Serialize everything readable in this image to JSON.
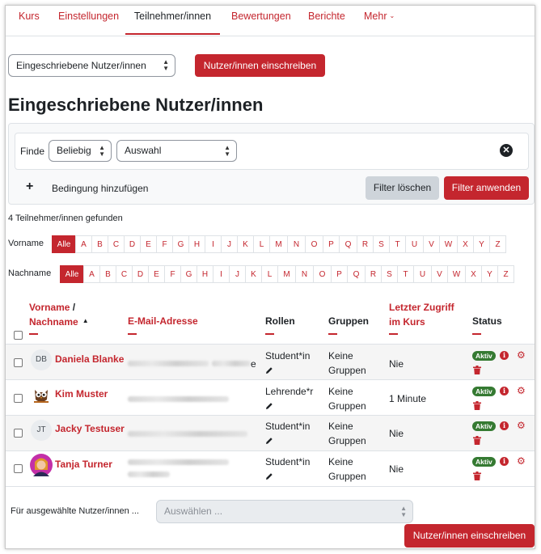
{
  "nav": {
    "tabs": [
      "Kurs",
      "Einstellungen",
      "Teilnehmer/innen",
      "Bewertungen",
      "Berichte",
      "Mehr"
    ],
    "active": "Teilnehmer/innen"
  },
  "toolbar": {
    "page_select": "Eingeschriebene Nutzer/innen",
    "enrol_button": "Nutzer/innen einschreiben"
  },
  "page_title": "Eingeschriebene Nutzer/innen",
  "filter": {
    "match_label": "Finde",
    "match_value": "Beliebig",
    "type_value": "Auswahl",
    "add_condition": "Bedingung hinzufügen",
    "clear_button": "Filter löschen",
    "apply_button": "Filter anwenden"
  },
  "results_count": "4 Teilnehmer/innen gefunden",
  "initials": {
    "firstname_label": "Vorname",
    "lastname_label": "Nachname",
    "all_label": "Alle",
    "letters": [
      "A",
      "B",
      "C",
      "D",
      "E",
      "F",
      "G",
      "H",
      "I",
      "J",
      "K",
      "L",
      "M",
      "N",
      "O",
      "P",
      "Q",
      "R",
      "S",
      "T",
      "U",
      "V",
      "W",
      "X",
      "Y",
      "Z"
    ]
  },
  "table": {
    "headers": {
      "firstname": "Vorname",
      "separator": " /",
      "lastname": "Nachname",
      "email": "E-Mail-Adresse",
      "roles": "Rollen",
      "groups": "Gruppen",
      "lastaccess_line1": "Letzter Zugriff",
      "lastaccess_line2": "im Kurs",
      "status": "Status"
    },
    "rows": [
      {
        "initials": "DB",
        "name": "Daniela Blanke",
        "email_tail": "e",
        "role": "Student*in",
        "groups_line1": "Keine",
        "groups_line2": "Gruppen",
        "last_access": "Nie",
        "status": "Aktiv"
      },
      {
        "initials": "",
        "name": "Kim Muster",
        "email_tail": "",
        "role": "Lehrende*r",
        "groups_line1": "Keine",
        "groups_line2": "Gruppen",
        "last_access": "1 Minute",
        "status": "Aktiv"
      },
      {
        "initials": "JT",
        "name": "Jacky Testuser",
        "email_tail": "",
        "role": "Student*in",
        "groups_line1": "Keine",
        "groups_line2": "Gruppen",
        "last_access": "Nie",
        "status": "Aktiv"
      },
      {
        "initials": "",
        "name": "Tanja Turner",
        "email_tail": "",
        "role": "Student*in",
        "groups_line1": "Keine",
        "groups_line2": "Gruppen",
        "last_access": "Nie",
        "status": "Aktiv"
      }
    ]
  },
  "bulk": {
    "label": "Für ausgewählte Nutzer/innen ...",
    "select_value": "Auswählen ..."
  },
  "footer": {
    "enrol_button": "Nutzer/innen einschreiben"
  },
  "colors": {
    "accent": "#c4262e",
    "badge_active": "#357a32"
  }
}
